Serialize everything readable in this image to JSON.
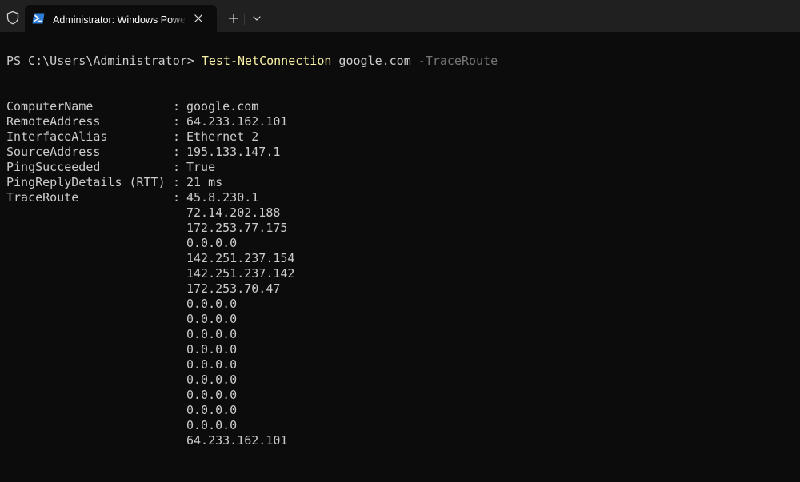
{
  "window": {
    "tab_title": "Administrator: Windows PowerShell",
    "icons": {
      "shield": "shield-icon",
      "tab": "powershell-icon",
      "close": "close-icon",
      "new_tab": "plus-icon",
      "dropdown": "chevron-down-icon"
    }
  },
  "terminal": {
    "prompt": "PS C:\\Users\\Administrator> ",
    "command": "Test-NetConnection",
    "argument": " google.com ",
    "parameter": "-TraceRoute",
    "colors": {
      "background": "#0c0c0c",
      "text": "#cccccc",
      "command": "#f9f1a5",
      "parameter": "#767676"
    },
    "properties": [
      {
        "name": "ComputerName",
        "value": "google.com"
      },
      {
        "name": "RemoteAddress",
        "value": "64.233.162.101"
      },
      {
        "name": "InterfaceAlias",
        "value": "Ethernet 2"
      },
      {
        "name": "SourceAddress",
        "value": "195.133.147.1"
      },
      {
        "name": "PingSucceeded",
        "value": "True"
      },
      {
        "name": "PingReplyDetails (RTT)",
        "value": "21 ms"
      },
      {
        "name": "TraceRoute",
        "value": "45.8.230.1"
      }
    ],
    "colon": ":",
    "trace_hops": [
      "72.14.202.188",
      "172.253.77.175",
      "0.0.0.0",
      "142.251.237.154",
      "142.251.237.142",
      "172.253.70.47",
      "0.0.0.0",
      "0.0.0.0",
      "0.0.0.0",
      "0.0.0.0",
      "0.0.0.0",
      "0.0.0.0",
      "0.0.0.0",
      "0.0.0.0",
      "0.0.0.0",
      "64.233.162.101"
    ]
  }
}
